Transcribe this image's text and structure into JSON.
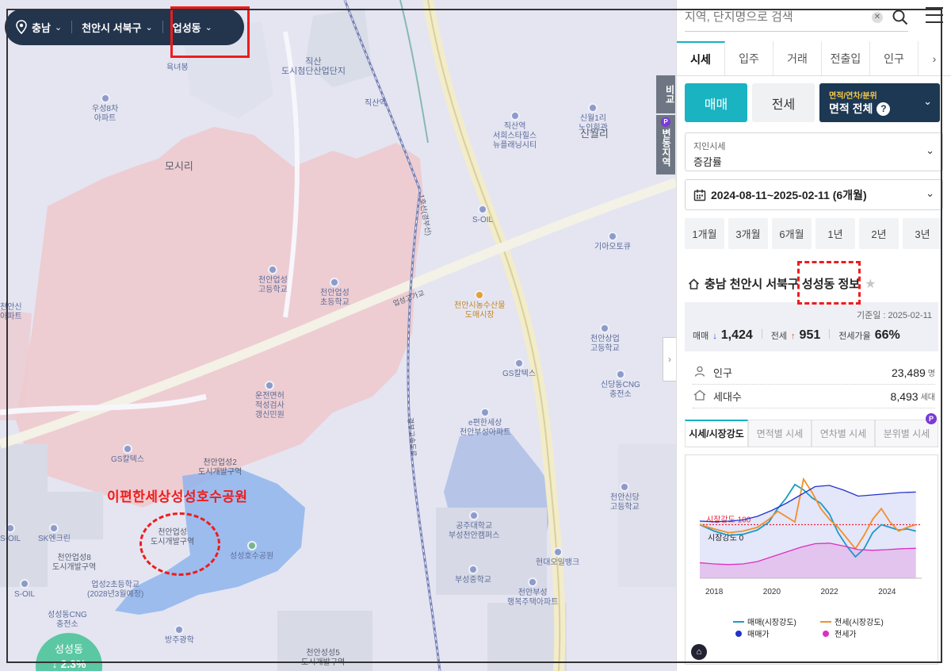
{
  "location_bar": {
    "province": "충남",
    "city": "천안시 서북구",
    "dong": "업성동"
  },
  "map_labels": {
    "place_large": [
      {
        "name": "모시리"
      },
      {
        "name": "신월리"
      }
    ],
    "places": [
      "육녀봉",
      "우성8차\n아파트",
      "직산\n도시첨단산업단지",
      "직산역",
      "직산역\n서희스타힐스\n뉴플래닝시티",
      "신월1리\n노인회관",
      "S-OIL",
      "기아오토큐",
      "천안업성\n고등학교",
      "천안업성\n초등학교",
      "천안시농수산물\n도매시장",
      "천안상업\n고등학교",
      "GS칼텍스",
      "신당동CNG\n충전소",
      "운전면허\n적성검사\n갱신민원",
      "e편한세상\n천안부성아파트",
      "GS칼텍스",
      "천안업성2\n도시개발구역",
      "천안신당\n고등학교",
      "공주대학교\n부성천안캠퍼스",
      "SK엔크린",
      "S-OIL",
      "천안업성8\n도시개발구역",
      "업성2초등학교\n(2028년3월예정)",
      "성성호수공원",
      "현대오일뱅크",
      "부성중학교",
      "천안부성\n행복주택아파트",
      "S-OIL",
      "성성동CNG\n충전소",
      "방주광학",
      "천안성성5\n도시개발구역",
      "천안업성\n도시개발구역",
      "천안신\n아파트",
      "업성고가교",
      "1호선(경부선)",
      "경부고속도로"
    ]
  },
  "annotation": {
    "title": "이편한세상성성호수공원"
  },
  "side_tabs": [
    {
      "label": "비교"
    },
    {
      "label": "변동지역"
    }
  ],
  "badge": {
    "name": "성성동",
    "value": "↓ 2.3%"
  },
  "search": {
    "placeholder": "지역, 단지명으로 검색"
  },
  "tabs": [
    "시세",
    "입주",
    "거래",
    "전출입",
    "인구",
    "›"
  ],
  "trade_buttons": {
    "sale": "매매",
    "lease": "전세",
    "area_small": "면적/연차/분위",
    "area_main": "면적 전체",
    "help": "?"
  },
  "filter": {
    "label": "지인시세",
    "value": "증감률"
  },
  "date_range": "2024-08-11~2025-02-11 (6개월)",
  "periods": [
    "1개월",
    "3개월",
    "6개월",
    "1년",
    "2년",
    "3년"
  ],
  "region_info": {
    "title": "충남 천안시 서북구 성성동 정보",
    "base_date": "기준일 : 2025-02-11",
    "sale_label": "매매",
    "sale_value": "1,424",
    "lease_label": "전세",
    "lease_value": "951",
    "ratio_label": "전세가율",
    "ratio_value": "66%",
    "population_label": "인구",
    "population_value": "23,489",
    "population_unit": "명",
    "households_label": "세대수",
    "households_value": "8,493",
    "households_unit": "세대"
  },
  "chart_tabs": [
    "시세/시장강도",
    "면적별 시세",
    "연차별 시세",
    "분위별 시세"
  ],
  "chart_data": {
    "type": "line",
    "x_ticks": [
      "2018",
      "2020",
      "2022",
      "2024"
    ],
    "xlim": [
      2017.5,
      2025.2
    ],
    "reference_label": "시장강도 100",
    "zero_label": "시장강도 0",
    "series": [
      {
        "name": "매매(시장강도)",
        "color": "#1c9bc7",
        "x": [
          2017.5,
          2018,
          2018.5,
          2019,
          2019.5,
          2019.9,
          2020.2,
          2020.5,
          2020.8,
          2021.1,
          2021.4,
          2021.7,
          2022.0,
          2022.3,
          2022.6,
          2022.9,
          2023.2,
          2023.5,
          2023.8,
          2024.1,
          2024.4,
          2024.7,
          2025.0
        ],
        "y": [
          100,
          88,
          80,
          82,
          90,
          105,
          130,
          150,
          175,
          165,
          150,
          140,
          120,
          85,
          60,
          40,
          55,
          85,
          100,
          95,
          90,
          92,
          88
        ]
      },
      {
        "name": "전세(시장강도)",
        "color": "#f0902a",
        "x": [
          2017.5,
          2018,
          2018.5,
          2019,
          2019.5,
          2019.9,
          2020.2,
          2020.5,
          2020.8,
          2021.1,
          2021.4,
          2021.7,
          2022.0,
          2022.3,
          2022.6,
          2022.9,
          2023.2,
          2023.5,
          2023.8,
          2024.1,
          2024.4,
          2024.7,
          2025.0
        ],
        "y": [
          100,
          92,
          85,
          88,
          95,
          110,
          125,
          115,
          105,
          185,
          160,
          130,
          110,
          95,
          75,
          55,
          80,
          110,
          130,
          105,
          88,
          95,
          100
        ]
      },
      {
        "name": "매매가",
        "color": "#2233cc",
        "x": [
          2017.5,
          2018,
          2018.5,
          2019,
          2019.5,
          2020,
          2020.5,
          2021,
          2021.5,
          2022,
          2022.5,
          2023,
          2023.5,
          2024,
          2024.5,
          2025
        ],
        "y": [
          1180,
          1175,
          1180,
          1190,
          1220,
          1270,
          1330,
          1400,
          1470,
          1480,
          1440,
          1390,
          1400,
          1410,
          1420,
          1424
        ]
      },
      {
        "name": "전세가",
        "color": "#dd2fbf",
        "x": [
          2017.5,
          2018,
          2018.5,
          2019,
          2019.5,
          2020,
          2020.5,
          2021,
          2021.5,
          2022,
          2022.5,
          2023,
          2023.5,
          2024,
          2024.5,
          2025
        ],
        "y": [
          830,
          820,
          815,
          820,
          840,
          880,
          920,
          960,
          990,
          995,
          970,
          940,
          935,
          940,
          948,
          951
        ]
      }
    ]
  }
}
